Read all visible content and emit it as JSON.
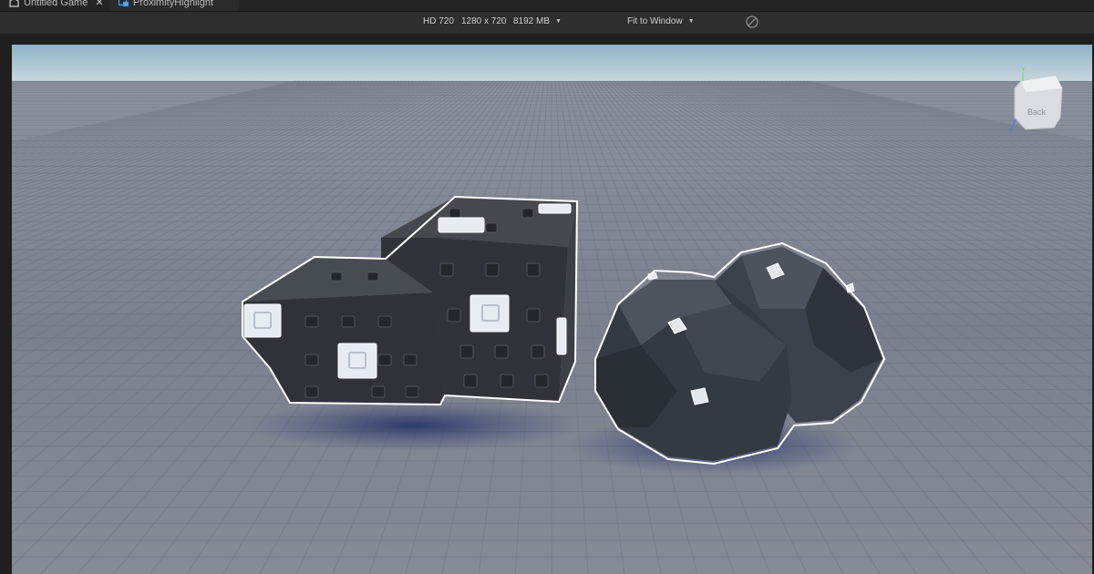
{
  "tabs": [
    {
      "label": "Untitled Game",
      "close": "✕"
    },
    {
      "label": "ProximityHighlight"
    }
  ],
  "device_bar": {
    "device": "HD 720",
    "resolution": "1280 x 720",
    "memory": "8192 MB",
    "fit": "Fit to Window"
  },
  "view_cube": {
    "face_label": "Back",
    "axis_y": "Y",
    "axis_z": "Z"
  },
  "colors": {
    "sky_top": "#8fb3c8",
    "sky_bottom": "#cbd8df",
    "baseplate": "#7e8594",
    "block": "#3a3f47",
    "highlight_outline": "#ffffff"
  }
}
